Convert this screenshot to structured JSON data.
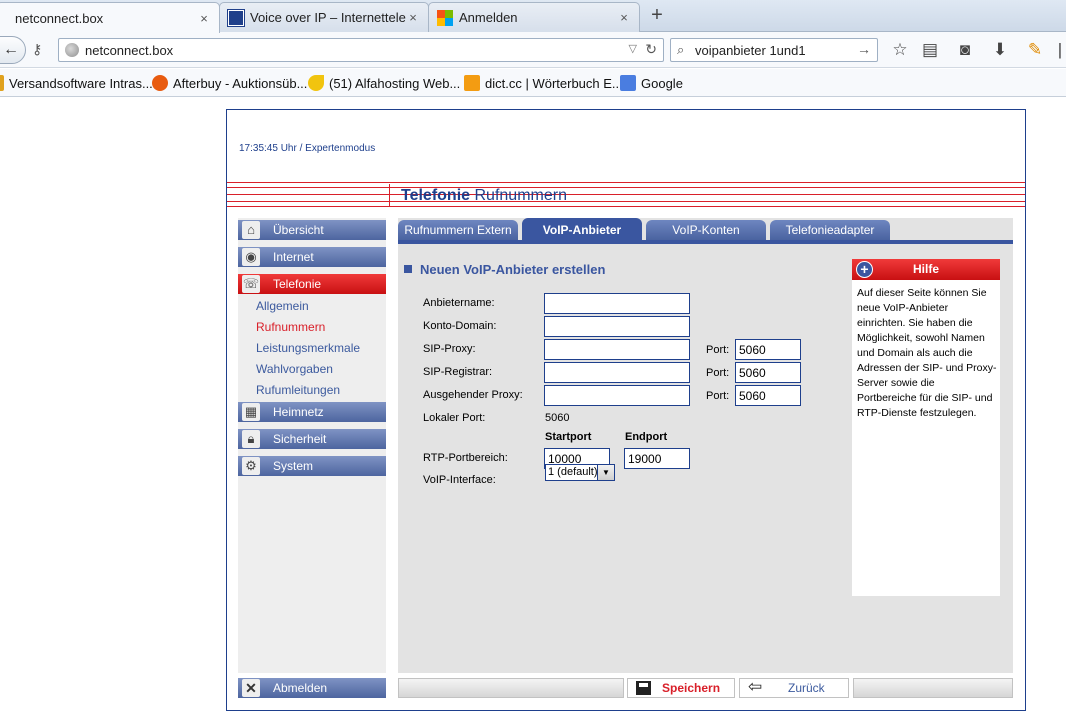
{
  "browser": {
    "tabs": [
      {
        "title": "netconnect.box",
        "active": true
      },
      {
        "title": "Voice over IP – Internettele...",
        "active": false
      },
      {
        "title": "Anmelden",
        "active": false
      }
    ],
    "close_glyph": "×",
    "new_tab_glyph": "+",
    "url": "netconnect.box",
    "search_query": "voipanbieter 1und1",
    "bookmarks": [
      {
        "label": "Versandsoftware Intras...",
        "color": "#e0a21f"
      },
      {
        "label": "Afterbuy - Auktionsüb...",
        "color": "#e85b10"
      },
      {
        "label": "(51) Alfahosting Web...",
        "color": "#f1c40f"
      },
      {
        "label": "dict.cc | Wörterbuch E...",
        "color": "#f39c12"
      },
      {
        "label": "Google",
        "color": "#4a7de0"
      }
    ]
  },
  "router": {
    "status": "17:35:45 Uhr  / Expertenmodus",
    "page_title_bold": "Telefonie",
    "page_title_rest": "Rufnummern",
    "nav": [
      {
        "label": "Übersicht",
        "icon": "home-icon"
      },
      {
        "label": "Internet",
        "icon": "globe-icon"
      },
      {
        "label": "Telefonie",
        "icon": "phone-icon",
        "active": true
      },
      {
        "label": "Heimnetz",
        "icon": "network-icon"
      },
      {
        "label": "Sicherheit",
        "icon": "lock-icon"
      },
      {
        "label": "System",
        "icon": "gears-icon"
      }
    ],
    "subnav": [
      "Allgemein",
      "Rufnummern",
      "Leistungsmerkmale",
      "Wahlvorgaben",
      "Rufumleitungen"
    ],
    "logout": "Abmelden",
    "tabs": [
      "Rufnummern Extern",
      "VoIP-Anbieter",
      "VoIP-Konten",
      "Telefonieadapter"
    ],
    "section_title": "Neuen VoIP-Anbieter erstellen",
    "fields": {
      "anbietername": {
        "label": "Anbietername:",
        "value": ""
      },
      "konto_domain": {
        "label": "Konto-Domain:",
        "value": ""
      },
      "sip_proxy": {
        "label": "SIP-Proxy:",
        "value": "",
        "port_label": "Port:",
        "port": "5060"
      },
      "sip_registrar": {
        "label": "SIP-Registrar:",
        "value": "",
        "port_label": "Port:",
        "port": "5060"
      },
      "outbound_proxy": {
        "label": "Ausgehender Proxy:",
        "value": "",
        "port_label": "Port:",
        "port": "5060"
      },
      "local_port": {
        "label": "Lokaler Port:",
        "value": "5060"
      },
      "rtp": {
        "label": "RTP-Portbereich:",
        "start_head": "Startport",
        "end_head": "Endport",
        "start": "10000",
        "end": "19000"
      },
      "voip_interface": {
        "label": "VoIP-Interface:",
        "value": "1 (default)"
      }
    },
    "help": {
      "title": "Hilfe",
      "text": "Auf dieser Seite können Sie neue VoIP-Anbieter einrichten. Sie haben die Möglichkeit, sowohl Namen und Domain als auch die Adressen der SIP- und Proxy-Server sowie die Portbereiche für die SIP- und RTP-Dienste festzulegen."
    },
    "save": "Speichern",
    "back": "Zurück"
  }
}
